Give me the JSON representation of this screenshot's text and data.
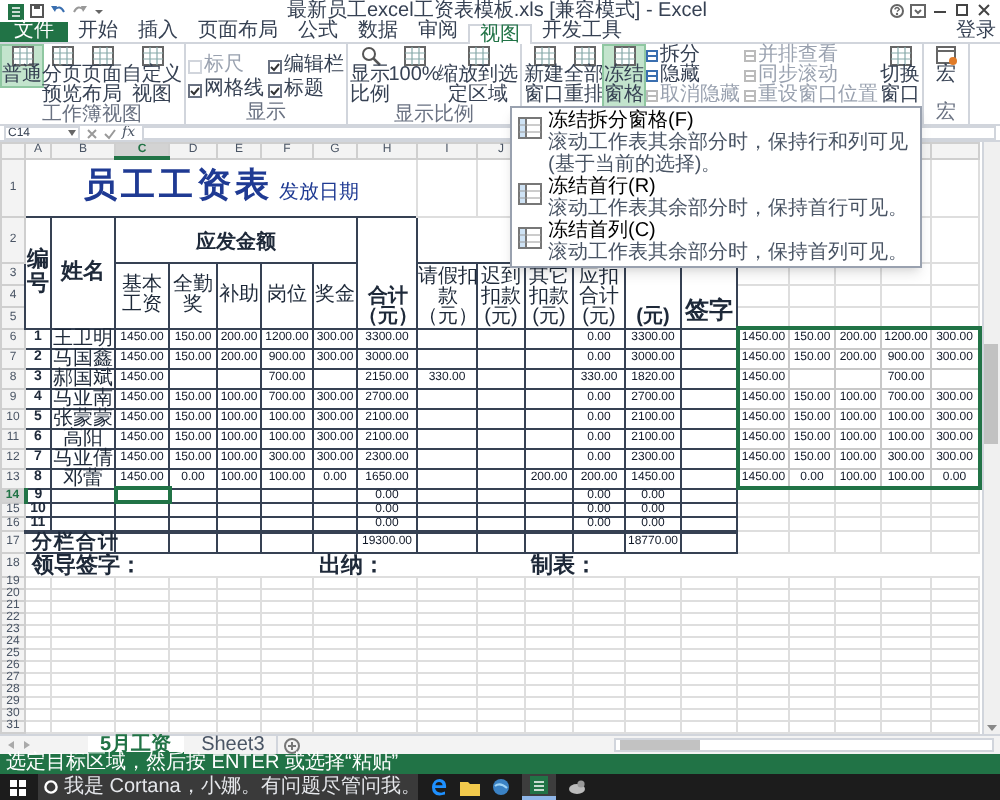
{
  "window": {
    "title": "最新员工excel工资表模板.xls [兼容模式] - Excel"
  },
  "ribbon": {
    "tabs": [
      {
        "label": "文件",
        "kind": "file",
        "selected": false
      },
      {
        "label": "开始",
        "kind": "tab",
        "selected": false
      },
      {
        "label": "插入",
        "kind": "tab",
        "selected": false
      },
      {
        "label": "页面布局",
        "kind": "tab",
        "selected": false
      },
      {
        "label": "公式",
        "kind": "tab",
        "selected": false
      },
      {
        "label": "数据",
        "kind": "tab",
        "selected": false
      },
      {
        "label": "审阅",
        "kind": "tab",
        "selected": false
      },
      {
        "label": "视图",
        "kind": "tab",
        "selected": true
      },
      {
        "label": "开发工具",
        "kind": "tab",
        "selected": false
      }
    ],
    "account": "登录",
    "groups": [
      {
        "label": "工作簿视图",
        "items": [
          {
            "kind": "large",
            "label": "普通",
            "selected": true
          },
          {
            "kind": "large",
            "label": "分页预览",
            "selected": false
          },
          {
            "kind": "large",
            "label": "页面布局",
            "selected": false
          },
          {
            "kind": "large",
            "label": "自定义视图",
            "selected": false
          }
        ]
      },
      {
        "label": "显示",
        "items": [
          {
            "kind": "checkbox",
            "label": "标尺",
            "checked": false,
            "disabled": true
          },
          {
            "kind": "checkbox",
            "label": "编辑栏",
            "checked": true,
            "disabled": false
          },
          {
            "kind": "checkbox",
            "label": "网格线",
            "checked": true,
            "disabled": false
          },
          {
            "kind": "checkbox",
            "label": "标题",
            "checked": true,
            "disabled": false
          }
        ]
      },
      {
        "label": "显示比例",
        "items": [
          {
            "kind": "large",
            "label": "显示比例",
            "selected": false
          },
          {
            "kind": "large",
            "label": "100%",
            "selected": false
          },
          {
            "kind": "large",
            "label": "缩放到选定区域",
            "selected": false
          }
        ]
      },
      {
        "items": [
          {
            "kind": "large",
            "label": "新建窗口",
            "selected": false
          },
          {
            "kind": "large",
            "label": "全部重排",
            "selected": false
          },
          {
            "kind": "large",
            "label": "冻结窗格",
            "selected": true
          },
          {
            "kind": "stack",
            "entries": [
              {
                "label": "拆分",
                "disabled": false
              },
              {
                "label": "隐藏",
                "disabled": false
              },
              {
                "label": "取消隐藏",
                "disabled": true
              }
            ]
          },
          {
            "kind": "stack",
            "entries": [
              {
                "label": "并排查看",
                "disabled": true
              },
              {
                "label": "同步滚动",
                "disabled": true
              },
              {
                "label": "重设窗口位置",
                "disabled": true
              }
            ]
          },
          {
            "kind": "large",
            "label": "切换窗口",
            "selected": false
          }
        ]
      },
      {
        "label": "宏",
        "items": [
          {
            "kind": "large",
            "label": "宏",
            "selected": false
          }
        ]
      }
    ]
  },
  "menu": {
    "items": [
      {
        "title": "冻结拆分窗格(F)",
        "description": "滚动工作表其余部分时，保持行和列可见(基于当前的选择)。"
      },
      {
        "title": "冻结首行(R)",
        "description": "滚动工作表其余部分时，保持首行可见。"
      },
      {
        "title": "冻结首列(C)",
        "description": "滚动工作表其余部分时，保持首列可见。"
      }
    ]
  },
  "sheet": {
    "name_box": "C14",
    "function_label": "fx",
    "columns": [
      {
        "letter": "A",
        "selected": false
      },
      {
        "letter": "B",
        "selected": false
      },
      {
        "letter": "C",
        "selected": true
      },
      {
        "letter": "D",
        "selected": false
      },
      {
        "letter": "E",
        "selected": false
      },
      {
        "letter": "F",
        "selected": false
      },
      {
        "letter": "G",
        "selected": false
      },
      {
        "letter": "H",
        "selected": false
      },
      {
        "letter": "I",
        "selected": false
      },
      {
        "letter": "J",
        "selected": false
      }
    ],
    "header_row_numbers": [
      "1",
      "2",
      "3",
      "4",
      "5"
    ],
    "title": "员工工资表",
    "title_note": "发放日期",
    "header": {
      "id": "编号",
      "name": "姓名",
      "earn_group": "应发金额",
      "earn": [
        "基本工资",
        "全勤奖",
        "补助",
        "岗位",
        "奖金"
      ],
      "total": "合计（元）",
      "deduct": [
        "请假扣款（元）",
        "迟到扣款(元)",
        "其它扣款(元)",
        "应扣合计(元)"
      ],
      "net": "(元)",
      "sign": "签字"
    },
    "rows": [
      {
        "row_number": "6",
        "no": "1",
        "name": "王卫明",
        "selected": false,
        "earn": {
          "basic": "1450.00",
          "attendance": "150.00",
          "subsidy": "200.00",
          "post": "1200.00",
          "bonus": "300.00"
        },
        "total": "3300.00",
        "deduct": {
          "total": "0.00"
        },
        "net": "3300.00",
        "copy": {
          "basic": "1450.00",
          "attendance": "150.00",
          "subsidy": "200.00",
          "post": "1200.00",
          "bonus": "300.00"
        }
      },
      {
        "row_number": "7",
        "no": "2",
        "name": "马国鑫",
        "selected": false,
        "earn": {
          "basic": "1450.00",
          "attendance": "150.00",
          "subsidy": "200.00",
          "post": "900.00",
          "bonus": "300.00"
        },
        "total": "3000.00",
        "deduct": {
          "total": "0.00"
        },
        "net": "3000.00",
        "copy": {
          "basic": "1450.00",
          "attendance": "150.00",
          "subsidy": "200.00",
          "post": "900.00",
          "bonus": "300.00"
        }
      },
      {
        "row_number": "8",
        "no": "3",
        "name": "郝国斌",
        "selected": false,
        "earn": {
          "basic": "1450.00",
          "post": "700.00"
        },
        "total": "2150.00",
        "deduct": {
          "leave": "330.00",
          "total": "330.00"
        },
        "net": "1820.00",
        "copy": {
          "basic": "1450.00",
          "post": "700.00"
        }
      },
      {
        "row_number": "9",
        "no": "4",
        "name": "马亚南",
        "selected": false,
        "earn": {
          "basic": "1450.00",
          "attendance": "150.00",
          "subsidy": "100.00",
          "post": "700.00",
          "bonus": "300.00"
        },
        "total": "2700.00",
        "deduct": {
          "total": "0.00"
        },
        "net": "2700.00",
        "copy": {
          "basic": "1450.00",
          "attendance": "150.00",
          "subsidy": "100.00",
          "post": "700.00",
          "bonus": "300.00"
        }
      },
      {
        "row_number": "10",
        "no": "5",
        "name": "张蒙蒙",
        "selected": false,
        "earn": {
          "basic": "1450.00",
          "attendance": "150.00",
          "subsidy": "100.00",
          "post": "100.00",
          "bonus": "300.00"
        },
        "total": "2100.00",
        "deduct": {
          "total": "0.00"
        },
        "net": "2100.00",
        "copy": {
          "basic": "1450.00",
          "attendance": "150.00",
          "subsidy": "100.00",
          "post": "100.00",
          "bonus": "300.00"
        }
      },
      {
        "row_number": "11",
        "no": "6",
        "name": "高阳",
        "selected": false,
        "earn": {
          "basic": "1450.00",
          "attendance": "150.00",
          "subsidy": "100.00",
          "post": "100.00",
          "bonus": "300.00"
        },
        "total": "2100.00",
        "deduct": {
          "total": "0.00"
        },
        "net": "2100.00",
        "copy": {
          "basic": "1450.00",
          "attendance": "150.00",
          "subsidy": "100.00",
          "post": "100.00",
          "bonus": "300.00"
        }
      },
      {
        "row_number": "12",
        "no": "7",
        "name": "马亚倩",
        "selected": false,
        "earn": {
          "basic": "1450.00",
          "attendance": "150.00",
          "subsidy": "100.00",
          "post": "300.00",
          "bonus": "300.00"
        },
        "total": "2300.00",
        "deduct": {
          "total": "0.00"
        },
        "net": "2300.00",
        "copy": {
          "basic": "1450.00",
          "attendance": "150.00",
          "subsidy": "100.00",
          "post": "300.00",
          "bonus": "300.00"
        }
      },
      {
        "row_number": "13",
        "no": "8",
        "name": "邓蕾",
        "selected": false,
        "earn": {
          "basic": "1450.00",
          "attendance": "0.00",
          "subsidy": "100.00",
          "post": "100.00",
          "bonus": "0.00"
        },
        "total": "1650.00",
        "deduct": {
          "other": "200.00",
          "total": "200.00"
        },
        "net": "1450.00",
        "copy": {
          "basic": "1450.00",
          "attendance": "0.00",
          "subsidy": "100.00",
          "post": "100.00",
          "bonus": "0.00"
        }
      },
      {
        "row_number": "14",
        "no": "9",
        "selected": true,
        "total": "0.00",
        "deduct": {
          "total": "0.00"
        },
        "net": "0.00"
      },
      {
        "row_number": "15",
        "no": "10",
        "selected": false,
        "total": "0.00",
        "deduct": {
          "total": "0.00"
        },
        "net": "0.00"
      },
      {
        "row_number": "16",
        "no": "11",
        "selected": false,
        "total": "0.00",
        "deduct": {
          "total": "0.00"
        },
        "net": "0.00"
      }
    ],
    "footer_row": {
      "row_number": "17",
      "label": "分栏合计",
      "total": "19300.00",
      "net": "18770.00"
    },
    "sign_row": {
      "row_number": "18",
      "labels": [
        "领导签字：",
        "出纳：",
        "制表："
      ]
    },
    "empty_rows": [
      "19",
      "20",
      "21",
      "22",
      "23",
      "24",
      "25",
      "26",
      "27",
      "28",
      "29",
      "30",
      "31"
    ]
  },
  "sheet_tabs": [
    {
      "label": "5月工资",
      "selected": true
    },
    {
      "label": "Sheet3",
      "selected": false
    }
  ],
  "status_bar": "选定目标区域，然后按 ENTER 或选择“粘贴”",
  "taskbar": {
    "search": "我是 Cortana，小娜。有问题尽管问我。"
  }
}
